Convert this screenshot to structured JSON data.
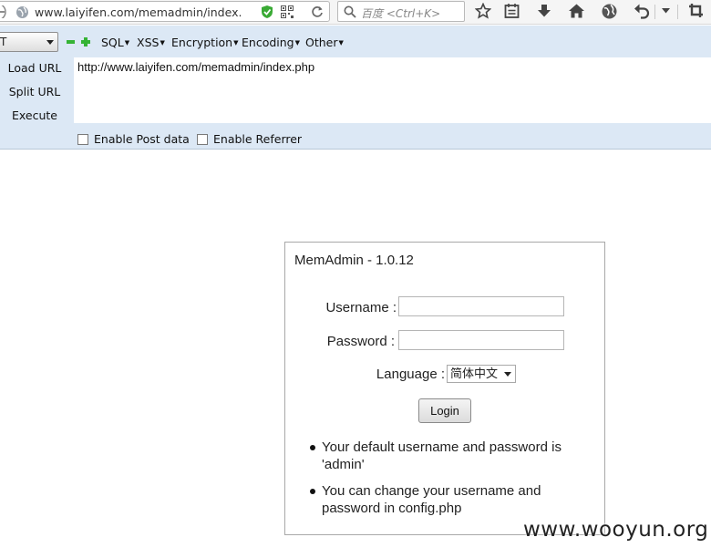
{
  "browser": {
    "url_display": "www.laiyifen.com/memadmin/index.p",
    "search_placeholder": "百度 <Ctrl+K>"
  },
  "hackbar": {
    "select_value": "T",
    "menus": [
      "SQL",
      "XSS",
      "Encryption",
      "Encoding",
      "Other"
    ],
    "buttons": {
      "load_url": "Load URL",
      "split_url": "Split URL",
      "execute": "Execute"
    },
    "url_value": "http://www.laiyifen.com/memadmin/index.php",
    "checkboxes": {
      "post_data": "Enable Post data",
      "referrer": "Enable Referrer"
    }
  },
  "login": {
    "title": "MemAdmin - 1.0.12",
    "username_label": "Username :",
    "password_label": "Password :",
    "language_label": "Language :",
    "language_value": "简体中文",
    "login_button": "Login",
    "notes": [
      "Your default username and password is 'admin'",
      "You can change your username and password in config.php"
    ]
  },
  "watermark": "www.wooyun.org",
  "colors": {
    "hackbar_bg": "#dce8f5",
    "shield_green": "#3aaa35"
  }
}
